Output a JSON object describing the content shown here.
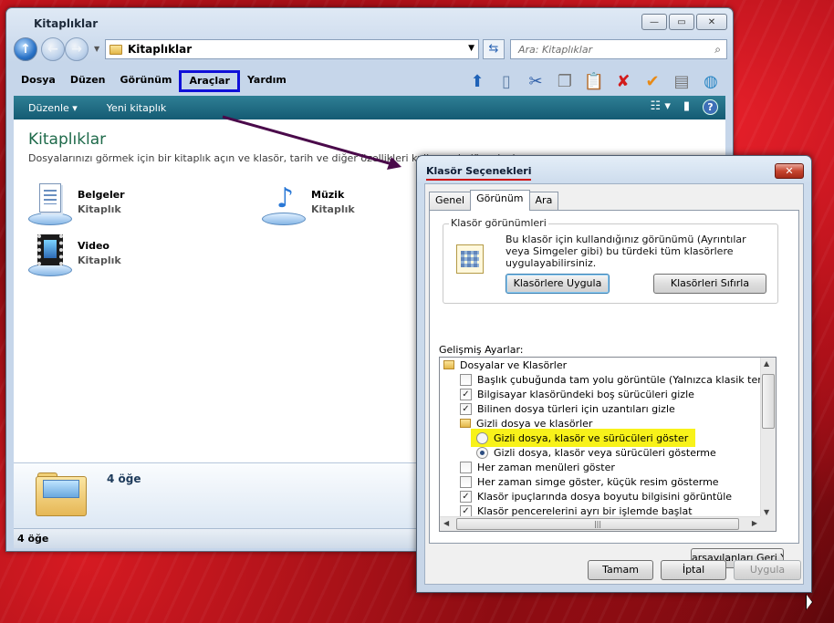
{
  "explorer": {
    "title": "Kitaplıklar",
    "window_buttons": {
      "minimize": "—",
      "maximize": "▭",
      "close": "✕"
    },
    "address": "Kitaplıklar",
    "search_placeholder": "Ara: Kitaplıklar",
    "menu": [
      "Dosya",
      "Düzen",
      "Görünüm",
      "Araçlar",
      "Yardım"
    ],
    "highlighted_menu": "Araçlar",
    "commands": {
      "organize": "Düzenle ▾",
      "new_library": "Yeni kitaplık"
    },
    "content": {
      "title": "Kitaplıklar",
      "description": "Dosyalarınızı görmek için bir kitaplık açın ve klasör, tarih ve diğer özellikleri kullanarak düzenleyin.",
      "libraries": [
        {
          "name": "Belgeler",
          "type": "Kitaplık"
        },
        {
          "name": "Müzik",
          "type": "Kitaplık"
        },
        {
          "name": "Video",
          "type": "Kitaplık"
        }
      ]
    },
    "details_count": "4 öğe",
    "status": "4 öğe"
  },
  "dialog": {
    "title": "Klasör Seçenekleri",
    "close": "✕",
    "tabs": [
      "Genel",
      "Görünüm",
      "Ara"
    ],
    "active_tab": "Görünüm",
    "folder_views": {
      "label": "Klasör görünümleri",
      "text": "Bu klasör için kullandığınız görünümü (Ayrıntılar veya Simgeler gibi) bu türdeki tüm klasörlere uygulayabilirsiniz.",
      "apply_button": "Klasörlere Uygula",
      "reset_button": "Klasörleri Sıfırla"
    },
    "advanced": {
      "label": "Gelişmiş Ayarlar:",
      "items": [
        {
          "kind": "folder",
          "text": "Dosyalar ve Klasörler",
          "level": 0
        },
        {
          "kind": "check",
          "text": "Başlık çubuğunda tam yolu görüntüle (Yalnızca klasik tema)",
          "checked": false,
          "level": 1
        },
        {
          "kind": "check",
          "text": "Bilgisayar klasöründeki boş sürücüleri gizle",
          "checked": true,
          "level": 1
        },
        {
          "kind": "check",
          "text": "Bilinen dosya türleri için uzantıları gizle",
          "checked": true,
          "level": 1
        },
        {
          "kind": "folder",
          "text": "Gizli dosya ve klasörler",
          "level": 1
        },
        {
          "kind": "radio",
          "text": "Gizli dosya, klasör ve sürücüleri göster",
          "selected": false,
          "level": 2,
          "highlight": true
        },
        {
          "kind": "radio",
          "text": "Gizli dosya, klasör veya sürücüleri gösterme",
          "selected": true,
          "level": 2
        },
        {
          "kind": "check",
          "text": "Her zaman menüleri göster",
          "checked": false,
          "level": 1
        },
        {
          "kind": "check",
          "text": "Her zaman simge göster, küçük resim gösterme",
          "checked": false,
          "level": 1
        },
        {
          "kind": "check",
          "text": "Klasör ipuçlarında dosya boyutu bilgisini görüntüle",
          "checked": true,
          "level": 1
        },
        {
          "kind": "check",
          "text": "Klasör pencerelerini ayrı bir işlemde başlat",
          "checked": true,
          "level": 1
        }
      ]
    },
    "restore_button": "arsayılanları Geri Yükl",
    "ok_button": "Tamam",
    "cancel_button": "İptal",
    "apply_button": "Uygula"
  }
}
